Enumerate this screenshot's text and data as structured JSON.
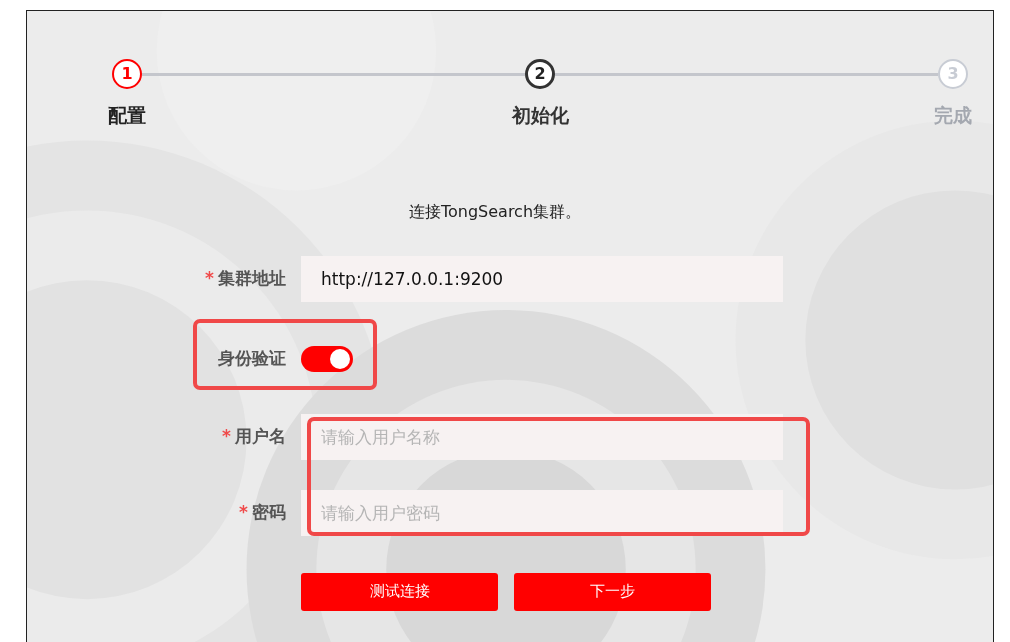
{
  "steps": [
    {
      "number": "1",
      "label": "配置",
      "error": true,
      "selected": false
    },
    {
      "number": "2",
      "label": "初始化",
      "error": false,
      "selected": true
    },
    {
      "number": "3",
      "label": "完成",
      "error": false,
      "selected": false
    }
  ],
  "intro": "连接TongSearch集群。",
  "address": {
    "label": "集群地址",
    "required_mark": "*",
    "value": "http://127.0.0.1:9200"
  },
  "auth": {
    "label": "身份验证",
    "on": true,
    "highlighted": true
  },
  "credentials": {
    "highlighted": true,
    "fields": [
      {
        "label": "用户名",
        "required_mark": "*",
        "placeholder": "请输入用户名称"
      },
      {
        "label": "密码",
        "required_mark": "*",
        "placeholder": "请输入用户密码"
      }
    ]
  },
  "buttons": [
    "测试连接",
    "下一步"
  ]
}
